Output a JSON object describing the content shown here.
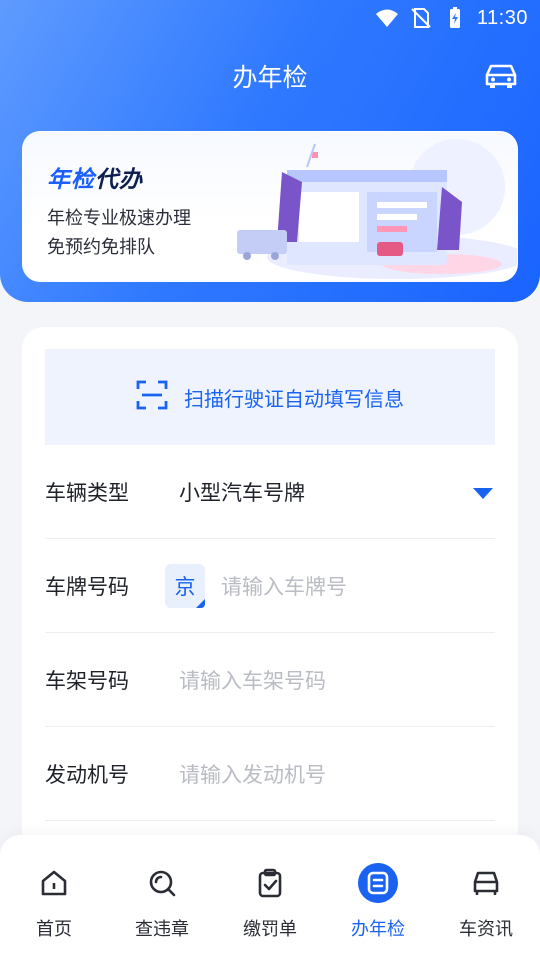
{
  "status_bar": {
    "time": "11:30",
    "icons": [
      "wifi-icon",
      "no-sim-icon",
      "battery-charging-icon"
    ]
  },
  "header": {
    "title": "办年检",
    "car_icon": "car-icon"
  },
  "banner": {
    "brand_part1": "年检",
    "brand_part2": "代办",
    "line1": "年检专业极速办理",
    "line2": "免预约免排队"
  },
  "scan": {
    "label": "扫描行驶证自动填写信息",
    "icon": "scan-icon"
  },
  "form": {
    "vehicle_type": {
      "label": "车辆类型",
      "value": "小型汽车号牌"
    },
    "plate": {
      "label": "车牌号码",
      "province": "京",
      "placeholder": "请输入车牌号"
    },
    "frame": {
      "label": "车架号码",
      "placeholder": "请输入车架号码"
    },
    "engine": {
      "label": "发动机号",
      "placeholder": "请输入发动机号"
    }
  },
  "tabs": [
    {
      "label": "首页",
      "icon": "home-icon"
    },
    {
      "label": "查违章",
      "icon": "search-icon"
    },
    {
      "label": "缴罚单",
      "icon": "clipboard-check-icon"
    },
    {
      "label": "办年检",
      "icon": "document-icon",
      "active": true
    },
    {
      "label": "车资讯",
      "icon": "car-front-icon"
    }
  ],
  "colors": {
    "primary": "#1a63f0",
    "header_start": "#5f9bff",
    "header_end": "#1a64ff"
  }
}
